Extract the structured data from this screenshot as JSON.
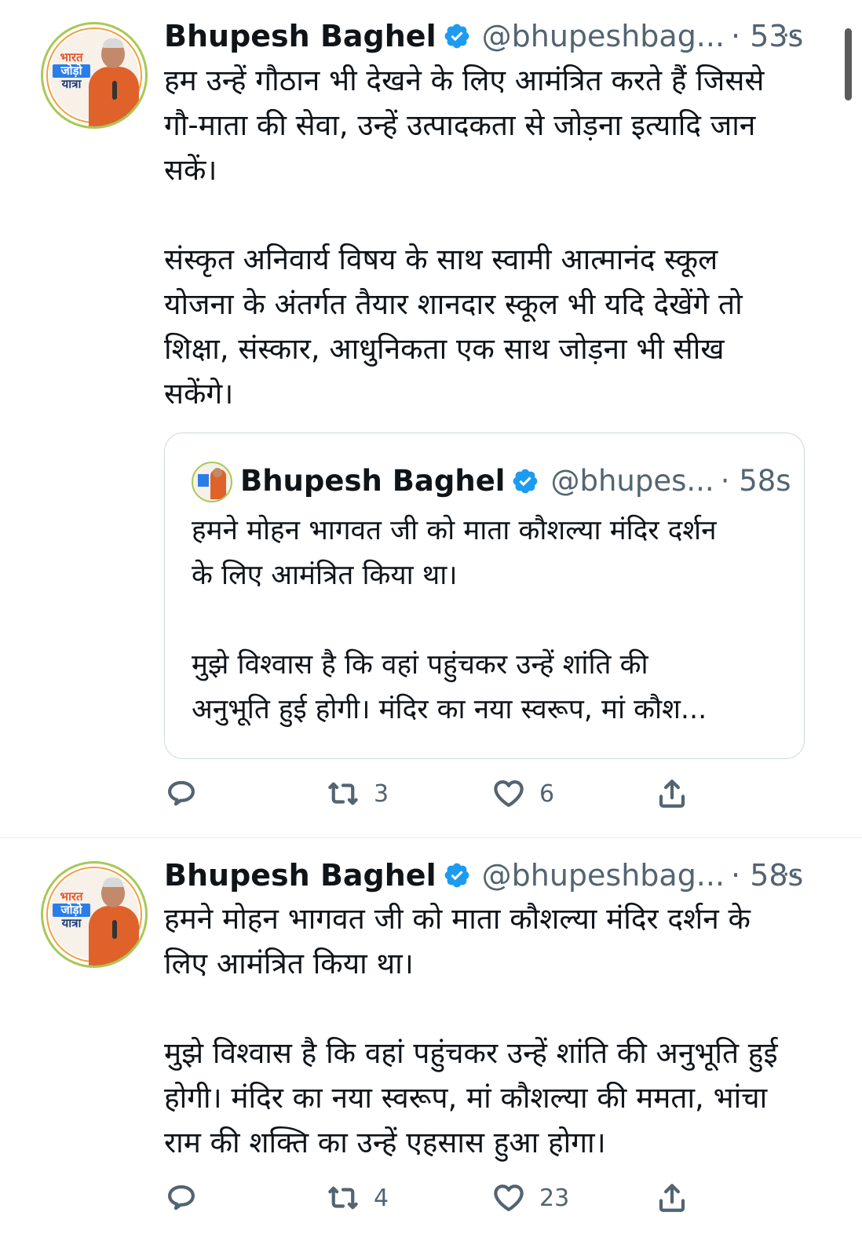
{
  "tweets": [
    {
      "name": "Bhupesh Baghel",
      "handle": "@bhupeshbag...",
      "time": "· 53s",
      "more": "···",
      "avatar_text": [
        "भारत",
        "जोड़ो",
        "यात्रा"
      ],
      "text": "हम उन्हें गौठान भी देखने के लिए आमंत्रित करते हैं जिससे\nगौ-माता की सेवा, उन्हें उत्पादकता से जोड़ना इत्यादि जान\nसकें।\n\nसंस्कृत अनिवार्य विषय के साथ स्वामी आत्मानंद स्कूल\nयोजना के अंतर्गत तैयार शानदार स्कूल भी यदि देखेंगे तो\nशिक्षा, संस्कार, आधुनिकता एक साथ जोड़ना भी सीख\nसकेंगे।",
      "quote": {
        "name": "Bhupesh Baghel",
        "handle": "@bhupes...",
        "time": "· 58s",
        "text": "हमने मोहन भागवत जी को माता कौशल्या मंदिर दर्शन\nके लिए आमंत्रित किया था।\n\nमुझे विश्वास है कि वहां पहुंचकर उन्हें शांति की\nअनुभूति हुई होगी। मंदिर का नया स्वरूप, मां कौश..."
      },
      "retweets": "3",
      "likes": "6"
    },
    {
      "name": "Bhupesh Baghel",
      "handle": "@bhupeshbag...",
      "time": "· 58s",
      "more": "···",
      "avatar_text": [
        "भारत",
        "जोड़ो",
        "यात्रा"
      ],
      "text": "हमने मोहन भागवत जी को माता कौशल्या मंदिर दर्शन के\nलिए आमंत्रित किया था।\n\nमुझे विश्वास है कि वहां पहुंचकर उन्हें शांति की अनुभूति हुई\nहोगी। मंदिर का नया स्वरूप, मां कौशल्या की ममता, भांचा\nराम की शक्ति का उन्हें एहसास हुआ होगा।",
      "retweets": "4",
      "likes": "23"
    }
  ],
  "colors": {
    "verified": "#1d9bf0",
    "secondary": "#536471",
    "border": "#cfd9de"
  },
  "icons": [
    "reply-icon",
    "retweet-icon",
    "like-icon",
    "share-icon",
    "verified-badge-icon",
    "more-icon"
  ]
}
